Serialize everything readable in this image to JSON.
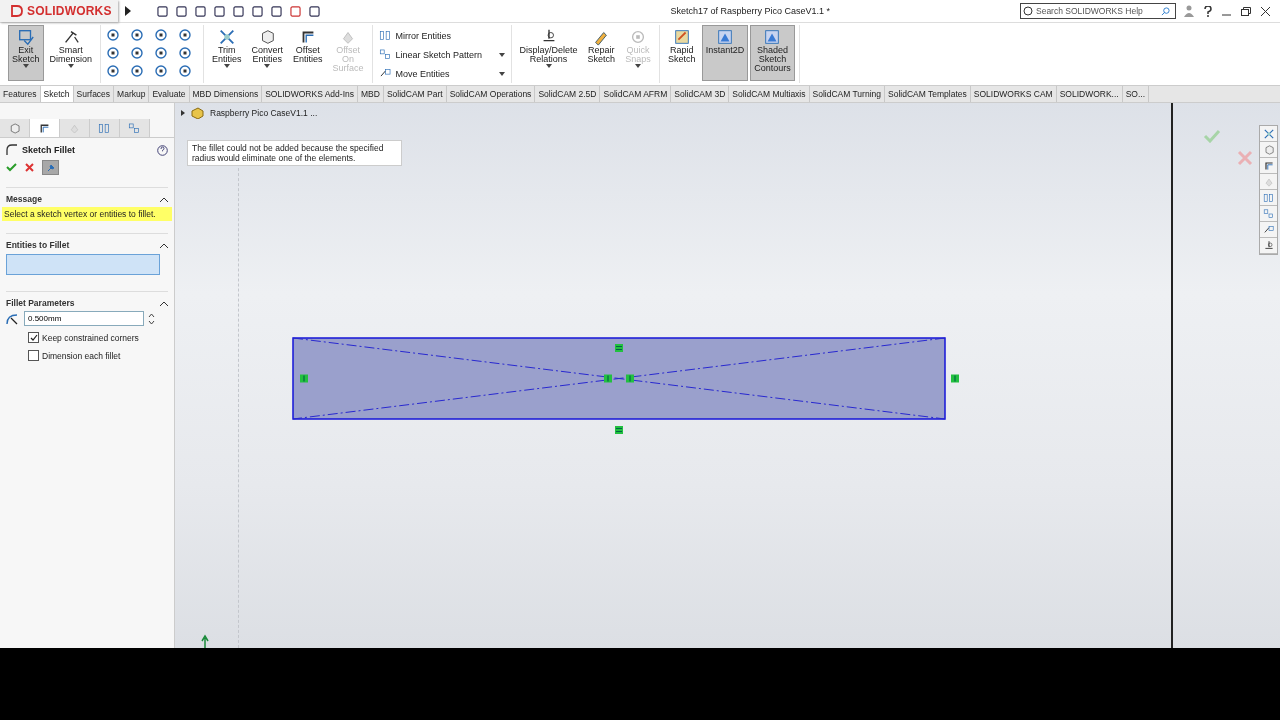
{
  "title_bar": {
    "logo": "SOLIDWORKS",
    "title": "Sketch17 of Raspberry Pico CaseV1.1 *",
    "search": {
      "placeholder": "Search SOLIDWORKS Help"
    }
  },
  "ribbon": {
    "groups": [
      {
        "items": [
          {
            "label": "Exit Sketch",
            "kind": "large",
            "selected": true,
            "disabled": false,
            "menu": true
          },
          {
            "label": "Smart Dimension",
            "kind": "large",
            "selected": false,
            "disabled": false,
            "menu": true
          }
        ]
      },
      {
        "items": [
          {
            "label": "Trim Entities",
            "kind": "large",
            "selected": false,
            "disabled": false,
            "menu": true
          },
          {
            "label": "Convert Entities",
            "kind": "large",
            "selected": false,
            "disabled": false,
            "menu": true
          },
          {
            "label": "Offset Entities",
            "kind": "large",
            "selected": false,
            "disabled": false,
            "menu": false
          },
          {
            "label": "Offset On Surface",
            "kind": "large",
            "selected": false,
            "disabled": true,
            "menu": false
          }
        ]
      },
      {
        "items": [
          {
            "label": "Mirror Entities",
            "kind": "row",
            "selected": false,
            "disabled": false,
            "menu": false
          },
          {
            "label": "Linear Sketch Pattern",
            "kind": "row",
            "selected": false,
            "disabled": false,
            "menu": true
          },
          {
            "label": "Move Entities",
            "kind": "row",
            "selected": false,
            "disabled": false,
            "menu": true
          }
        ]
      },
      {
        "items": [
          {
            "label": "Display/Delete Relations",
            "kind": "large",
            "selected": false,
            "disabled": false,
            "menu": true
          },
          {
            "label": "Repair Sketch",
            "kind": "large",
            "selected": false,
            "disabled": false,
            "menu": false
          },
          {
            "label": "Quick Snaps",
            "kind": "large",
            "selected": false,
            "disabled": true,
            "menu": true
          }
        ]
      },
      {
        "items": [
          {
            "label": "Rapid Sketch",
            "kind": "large",
            "selected": false,
            "disabled": false,
            "menu": false
          },
          {
            "label": "Instant2D",
            "kind": "large",
            "selected": true,
            "disabled": false,
            "menu": false
          },
          {
            "label": "Shaded Sketch Contours",
            "kind": "large",
            "selected": true,
            "disabled": false,
            "menu": false
          }
        ]
      }
    ]
  },
  "tabs": [
    {
      "label": "Features",
      "selected": false
    },
    {
      "label": "Sketch",
      "selected": true
    },
    {
      "label": "Surfaces",
      "selected": false
    },
    {
      "label": "Markup",
      "selected": false
    },
    {
      "label": "Evaluate",
      "selected": false
    },
    {
      "label": "MBD Dimensions",
      "selected": false
    },
    {
      "label": "SOLIDWORKS Add-Ins",
      "selected": false
    },
    {
      "label": "MBD",
      "selected": false
    },
    {
      "label": "SolidCAM Part",
      "selected": false
    },
    {
      "label": "SolidCAM Operations",
      "selected": false
    },
    {
      "label": "SolidCAM 2.5D",
      "selected": false
    },
    {
      "label": "SolidCAM AFRM",
      "selected": false
    },
    {
      "label": "SolidCAM 3D",
      "selected": false
    },
    {
      "label": "SolidCAM Multiaxis",
      "selected": false
    },
    {
      "label": "SolidCAM Turning",
      "selected": false
    },
    {
      "label": "SolidCAM Templates",
      "selected": false
    },
    {
      "label": "SOLIDWORKS CAM",
      "selected": false
    },
    {
      "label": "SOLIDWORK...",
      "selected": false
    },
    {
      "label": "SO...",
      "selected": false
    }
  ],
  "panel": {
    "tabs": [
      {
        "selected": false
      },
      {
        "selected": true
      },
      {
        "selected": false
      },
      {
        "selected": false
      },
      {
        "selected": false
      }
    ],
    "title": "Sketch Fillet",
    "message": {
      "title": "Message",
      "text": "Select a sketch vertex or entities to fillet."
    },
    "entities": {
      "title": "Entities to Fillet"
    },
    "parameters": {
      "title": "Fillet Parameters",
      "radius": "0.500mm",
      "options": [
        {
          "label": "Keep constrained corners",
          "checked": true
        },
        {
          "label": "Dimension each fillet",
          "checked": false
        }
      ]
    }
  },
  "canvas": {
    "breadcrumb": "Raspberry Pico CaseV1.1 ...",
    "tooltip": "The fillet could not be added because the specified radius would eliminate one of the elements."
  }
}
